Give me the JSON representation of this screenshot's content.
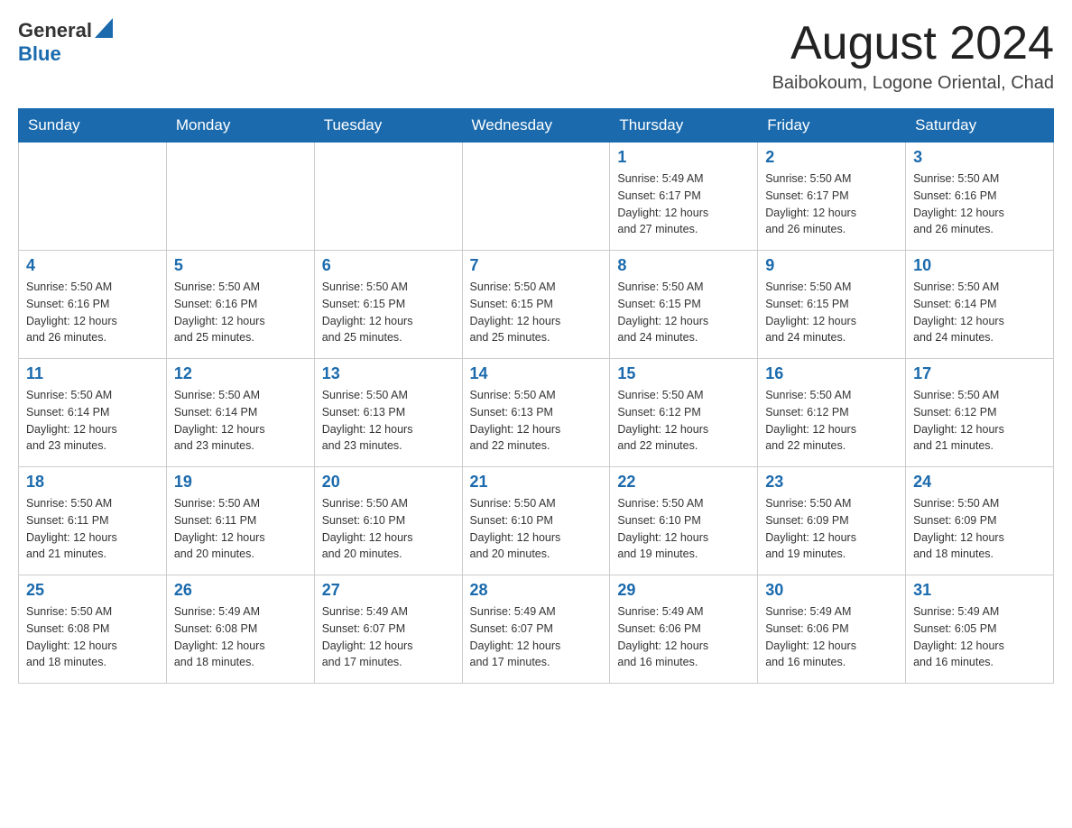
{
  "header": {
    "logo_general": "General",
    "logo_blue": "Blue",
    "month_title": "August 2024",
    "location": "Baibokoum, Logone Oriental, Chad"
  },
  "days_of_week": [
    "Sunday",
    "Monday",
    "Tuesday",
    "Wednesday",
    "Thursday",
    "Friday",
    "Saturday"
  ],
  "weeks": [
    [
      {
        "day": "",
        "info": ""
      },
      {
        "day": "",
        "info": ""
      },
      {
        "day": "",
        "info": ""
      },
      {
        "day": "",
        "info": ""
      },
      {
        "day": "1",
        "info": "Sunrise: 5:49 AM\nSunset: 6:17 PM\nDaylight: 12 hours\nand 27 minutes."
      },
      {
        "day": "2",
        "info": "Sunrise: 5:50 AM\nSunset: 6:17 PM\nDaylight: 12 hours\nand 26 minutes."
      },
      {
        "day": "3",
        "info": "Sunrise: 5:50 AM\nSunset: 6:16 PM\nDaylight: 12 hours\nand 26 minutes."
      }
    ],
    [
      {
        "day": "4",
        "info": "Sunrise: 5:50 AM\nSunset: 6:16 PM\nDaylight: 12 hours\nand 26 minutes."
      },
      {
        "day": "5",
        "info": "Sunrise: 5:50 AM\nSunset: 6:16 PM\nDaylight: 12 hours\nand 25 minutes."
      },
      {
        "day": "6",
        "info": "Sunrise: 5:50 AM\nSunset: 6:15 PM\nDaylight: 12 hours\nand 25 minutes."
      },
      {
        "day": "7",
        "info": "Sunrise: 5:50 AM\nSunset: 6:15 PM\nDaylight: 12 hours\nand 25 minutes."
      },
      {
        "day": "8",
        "info": "Sunrise: 5:50 AM\nSunset: 6:15 PM\nDaylight: 12 hours\nand 24 minutes."
      },
      {
        "day": "9",
        "info": "Sunrise: 5:50 AM\nSunset: 6:15 PM\nDaylight: 12 hours\nand 24 minutes."
      },
      {
        "day": "10",
        "info": "Sunrise: 5:50 AM\nSunset: 6:14 PM\nDaylight: 12 hours\nand 24 minutes."
      }
    ],
    [
      {
        "day": "11",
        "info": "Sunrise: 5:50 AM\nSunset: 6:14 PM\nDaylight: 12 hours\nand 23 minutes."
      },
      {
        "day": "12",
        "info": "Sunrise: 5:50 AM\nSunset: 6:14 PM\nDaylight: 12 hours\nand 23 minutes."
      },
      {
        "day": "13",
        "info": "Sunrise: 5:50 AM\nSunset: 6:13 PM\nDaylight: 12 hours\nand 23 minutes."
      },
      {
        "day": "14",
        "info": "Sunrise: 5:50 AM\nSunset: 6:13 PM\nDaylight: 12 hours\nand 22 minutes."
      },
      {
        "day": "15",
        "info": "Sunrise: 5:50 AM\nSunset: 6:12 PM\nDaylight: 12 hours\nand 22 minutes."
      },
      {
        "day": "16",
        "info": "Sunrise: 5:50 AM\nSunset: 6:12 PM\nDaylight: 12 hours\nand 22 minutes."
      },
      {
        "day": "17",
        "info": "Sunrise: 5:50 AM\nSunset: 6:12 PM\nDaylight: 12 hours\nand 21 minutes."
      }
    ],
    [
      {
        "day": "18",
        "info": "Sunrise: 5:50 AM\nSunset: 6:11 PM\nDaylight: 12 hours\nand 21 minutes."
      },
      {
        "day": "19",
        "info": "Sunrise: 5:50 AM\nSunset: 6:11 PM\nDaylight: 12 hours\nand 20 minutes."
      },
      {
        "day": "20",
        "info": "Sunrise: 5:50 AM\nSunset: 6:10 PM\nDaylight: 12 hours\nand 20 minutes."
      },
      {
        "day": "21",
        "info": "Sunrise: 5:50 AM\nSunset: 6:10 PM\nDaylight: 12 hours\nand 20 minutes."
      },
      {
        "day": "22",
        "info": "Sunrise: 5:50 AM\nSunset: 6:10 PM\nDaylight: 12 hours\nand 19 minutes."
      },
      {
        "day": "23",
        "info": "Sunrise: 5:50 AM\nSunset: 6:09 PM\nDaylight: 12 hours\nand 19 minutes."
      },
      {
        "day": "24",
        "info": "Sunrise: 5:50 AM\nSunset: 6:09 PM\nDaylight: 12 hours\nand 18 minutes."
      }
    ],
    [
      {
        "day": "25",
        "info": "Sunrise: 5:50 AM\nSunset: 6:08 PM\nDaylight: 12 hours\nand 18 minutes."
      },
      {
        "day": "26",
        "info": "Sunrise: 5:49 AM\nSunset: 6:08 PM\nDaylight: 12 hours\nand 18 minutes."
      },
      {
        "day": "27",
        "info": "Sunrise: 5:49 AM\nSunset: 6:07 PM\nDaylight: 12 hours\nand 17 minutes."
      },
      {
        "day": "28",
        "info": "Sunrise: 5:49 AM\nSunset: 6:07 PM\nDaylight: 12 hours\nand 17 minutes."
      },
      {
        "day": "29",
        "info": "Sunrise: 5:49 AM\nSunset: 6:06 PM\nDaylight: 12 hours\nand 16 minutes."
      },
      {
        "day": "30",
        "info": "Sunrise: 5:49 AM\nSunset: 6:06 PM\nDaylight: 12 hours\nand 16 minutes."
      },
      {
        "day": "31",
        "info": "Sunrise: 5:49 AM\nSunset: 6:05 PM\nDaylight: 12 hours\nand 16 minutes."
      }
    ]
  ]
}
